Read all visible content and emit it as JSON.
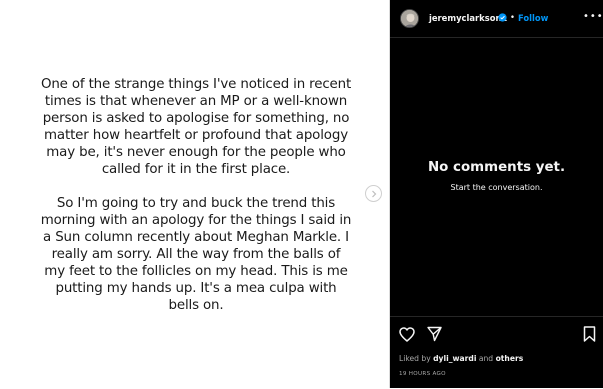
{
  "post": {
    "paragraphs": [
      "One of the strange things I've noticed in recent times is that whenever an MP or a well-known person is asked to apologise for something, no matter how heartfelt or profound that apology may be, it's never enough for the people who called for it in the first place.",
      "So I'm going to try and buck the trend this morning with an apology for the things I said in a Sun column recently about Meghan Markle. I really am sorry. All the way from the balls of my feet to the follicles on my head. This is me putting my hands up. It's a mea culpa with bells on."
    ]
  },
  "header": {
    "username": "jeremyclarkson1",
    "separator": "•",
    "follow_label": "Follow",
    "more_label": "•••"
  },
  "comments": {
    "empty_title": "No comments yet.",
    "empty_subtitle": "Start the conversation."
  },
  "footer": {
    "liked_by_prefix": "Liked by",
    "liked_by_user": "dyli_wardi",
    "liked_by_suffix": "and",
    "liked_by_others": "others",
    "timestamp": "19 HOURS AGO"
  },
  "icons": {
    "verified": "verified-badge-icon",
    "like": "heart-icon",
    "share": "paper-plane-icon",
    "save": "bookmark-icon",
    "next": "chevron-right-icon"
  },
  "colors": {
    "panel_bg": "#000000",
    "follow": "#0095f6",
    "verified": "#0095f6"
  }
}
